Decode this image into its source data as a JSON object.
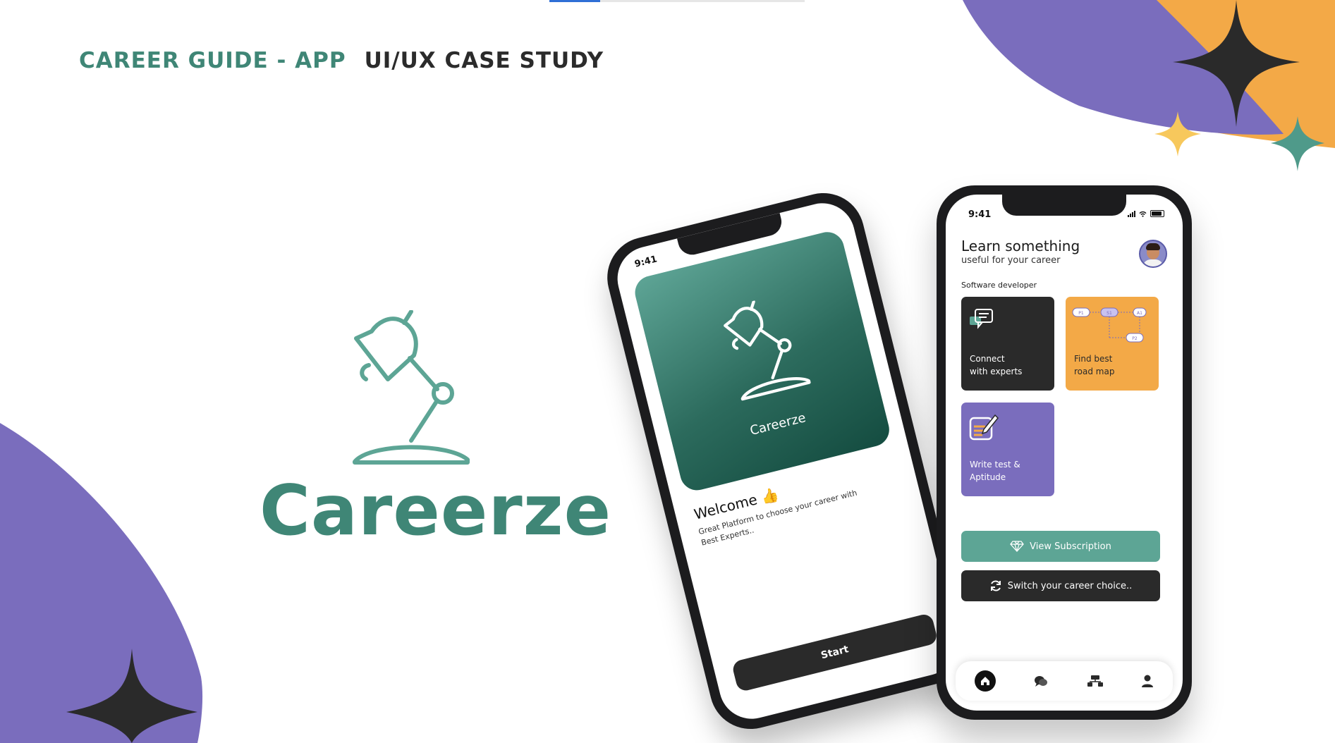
{
  "header": {
    "title_left": "CAREER GUIDE - APP",
    "title_right": "UI/UX CASE STUDY"
  },
  "brand": {
    "name": "Careerze"
  },
  "colors": {
    "teal": "#3f8676",
    "purple": "#7a6dbd",
    "orange": "#f3a947",
    "dark": "#2a2a2a"
  },
  "left_phone": {
    "status_time": "9:41",
    "splash_name": "Careerze",
    "welcome_title": "Welcome 👍",
    "welcome_text": "Great Platform to choose your career with Best Experts..",
    "start_label": "Start"
  },
  "right_phone": {
    "status_time": "9:41",
    "title": "Learn something",
    "subtitle": "useful for your career",
    "section_label": "Software developer",
    "cards": [
      {
        "label_line1": "Connect",
        "label_line2": "with experts",
        "icon": "chat-icon"
      },
      {
        "label_line1": "Find best",
        "label_line2": "road map",
        "icon": "roadmap-icon"
      },
      {
        "label_line1": "Write test &",
        "label_line2": "Aptitude",
        "icon": "write-test-icon"
      }
    ],
    "roadmap_nodes": [
      "P1",
      "S1",
      "A1",
      "P2"
    ],
    "view_subscription": "View Subscription",
    "switch_career": "Switch your career choice..",
    "nav": [
      "home-icon",
      "chat-bubbles-icon",
      "roadmap-nav-icon",
      "profile-icon"
    ]
  }
}
